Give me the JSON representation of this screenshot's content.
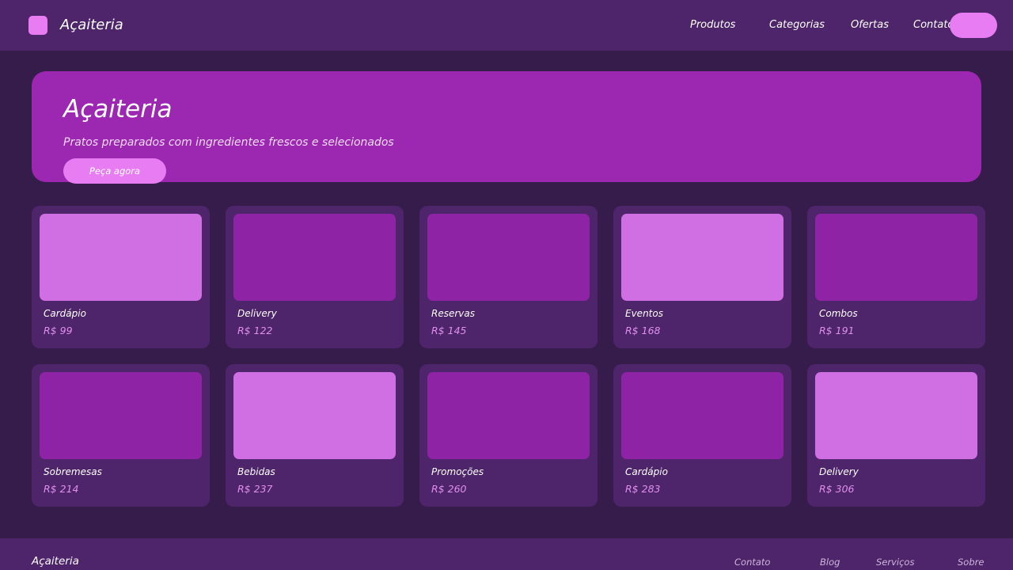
{
  "header": {
    "brand": "Açaiteria",
    "nav": [
      {
        "label": "Produtos"
      },
      {
        "label": "Categorias"
      },
      {
        "label": "Ofertas"
      },
      {
        "label": "Contato"
      }
    ]
  },
  "hero": {
    "title": "Açaiteria",
    "subtitle": "Pratos preparados com ingredientes frescos e selecionados",
    "cta_label": "Peça agora"
  },
  "products": [
    {
      "name": "Cardápio",
      "price": "R$ 99",
      "image_color": "#d06ee3"
    },
    {
      "name": "Delivery",
      "price": "R$ 122",
      "image_color": "#8e24a5"
    },
    {
      "name": "Reservas",
      "price": "R$ 145",
      "image_color": "#8e24a5"
    },
    {
      "name": "Eventos",
      "price": "R$ 168",
      "image_color": "#d06ee3"
    },
    {
      "name": "Combos",
      "price": "R$ 191",
      "image_color": "#8e24a5"
    },
    {
      "name": "Sobremesas",
      "price": "R$ 214",
      "image_color": "#8e24a5"
    },
    {
      "name": "Bebidas",
      "price": "R$ 237",
      "image_color": "#d06ee3"
    },
    {
      "name": "Promoções",
      "price": "R$ 260",
      "image_color": "#8e24a5"
    },
    {
      "name": "Cardápio",
      "price": "R$ 283",
      "image_color": "#8e24a5"
    },
    {
      "name": "Delivery",
      "price": "R$ 306",
      "image_color": "#d06ee3"
    }
  ],
  "footer": {
    "brand": "Açaiteria",
    "links": [
      {
        "label": "Contato"
      },
      {
        "label": "Blog"
      },
      {
        "label": "Serviços"
      },
      {
        "label": "Sobre"
      }
    ]
  },
  "colors": {
    "page_background": "#361c4a",
    "bar_background": "#4e256a",
    "hero_background": "#9c27b0",
    "accent": "#e87cf3",
    "price_text": "#e08ef0"
  }
}
